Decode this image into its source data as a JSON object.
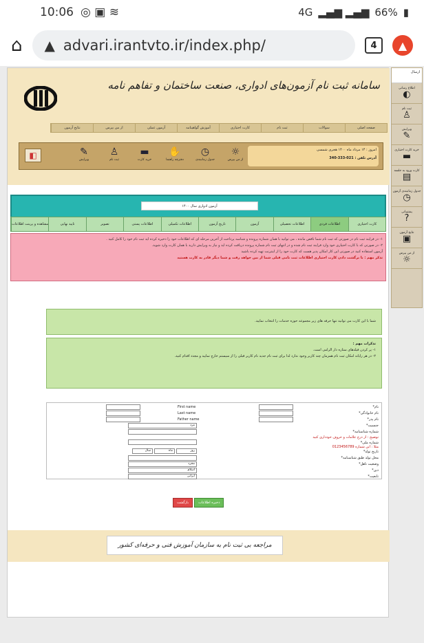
{
  "status_bar": {
    "time": "10:06",
    "battery": "66%",
    "network": "4G"
  },
  "browser": {
    "url": "advari.irantvto.ir/index.php/",
    "tab_count": "4"
  },
  "site": {
    "title": "سامانه ثبت نام آزمون‌های ادواری، صنعت ساختمان و تفاهم نامه",
    "nav": [
      "صفحه اصلی",
      "سوالات",
      "ثبت نام",
      "کارت احتیاری",
      "آموزش گواهینامه",
      "آزمون عملی",
      "از من بپرس",
      "نتایج آزمون"
    ],
    "icons": [
      "از من بپرس",
      "جدول زمانبندی",
      "دفترچه راهنما",
      "خرید کارت",
      "ثبت نام",
      "ویرایش"
    ],
    "info_date": "امروز : ۱۴ مرداد ماه ۱۴۰۰ هجری شمسی",
    "info_phone": "آدرس تلفن : 021-333-340",
    "year_label": "آزمون ادواری سال ۱۴۰۰",
    "steps": [
      "کارت احتیاری",
      "اطلاعات فردی",
      "اطلاعات تحصیلی",
      "آزمون",
      "تاریخ آزمون",
      "اطلاعات تکمیلی",
      "اطلاعات پستی",
      "تصویر",
      "تایید نهایی",
      "مشاهده و پرینت اطلاعات"
    ],
    "warn_lines": [
      "۱- در فرایند ثبت نام در صورتی که ثبت نام شما ناقص مانده ، می توانید با همان شماره پرونده و شناسه پرداخت از آخرین مرحله ای که اطلاعات خود را ذخیره کرده اید ثبت نام خود را کامل کنید .",
      "۲- در صورتی که با کارت احتیاری خود وارد فرایند ثبت نام شده و در انتهای ثبت نام شماره پرونده دریافت کرده اید و نیاز به ویرایش دارید با همان کارت وارد شوید.",
      "آزمون استفاده کنید در صورتی این کار امکان پذیر هست که کارت خود را از اینترنت تهیه کرده باشید",
      "تذکر مهم : با برگشت دادن کارت احتیاری اطلاعات ثبت نامی قبلی شما از بین خواهد رفت و شما دیگر قادر به کارت هستید"
    ],
    "info1": "شما با این کارت می توانید تنها حرفه های زیر مجموعه حوزه خدمات را انتخاب نمایید.",
    "info2_title": "تذکرات مهم :",
    "info2_lines": [
      "۱- پر کردن فیلدهای ستاره دار الزامی است.",
      "۲- در هر رایانه امکان ثبت نام همزمان چند کاربر وجود ندارد لذا برای ثبت نام جدید نام کاربر قبلی را از سیستم خارج نمایید و مجدد اقدام کنید."
    ],
    "form": {
      "labels_right": [
        "نام*",
        "نام خانوادگی*",
        "نام پدر*",
        "جنسیت*",
        "شماره شناسنامه*",
        "توضیح",
        "شماره ملی*",
        "تاریخ تولد*",
        "محل تولد طبق شناسنامه*",
        "وضعیت تاهل*",
        "دین*",
        "تابعیت*"
      ],
      "labels_left": [
        "First name",
        "Last name",
        "Father name"
      ],
      "gender": "مرد",
      "birth": [
        "روز",
        "ماه",
        "سال"
      ],
      "marital": "مجرد",
      "religion": "اسلام",
      "nationality": "ایرانی",
      "note": "توضیح : از درج علامات و حروف خودداری کنید",
      "nat_note": "مثلا : ابن شماره 0123456789"
    },
    "buttons": {
      "save": "ذخیره اطلاعات",
      "back": "بازگشت"
    },
    "footer": "مراجعه بی ثبت نام به سازمان آموزش فنی و حرفه‌ای کشور"
  },
  "sidebar": {
    "top": "ارسال",
    "items": [
      "اطلاع رسانی",
      "ثبت نام",
      "ویرایش",
      "خرید کارت احتیاری",
      "کارت ورود به جلسه",
      "جدول زمانبندی آزمون",
      "پشتیبانی",
      "نتایج آزمون",
      "از من بپرس"
    ]
  }
}
